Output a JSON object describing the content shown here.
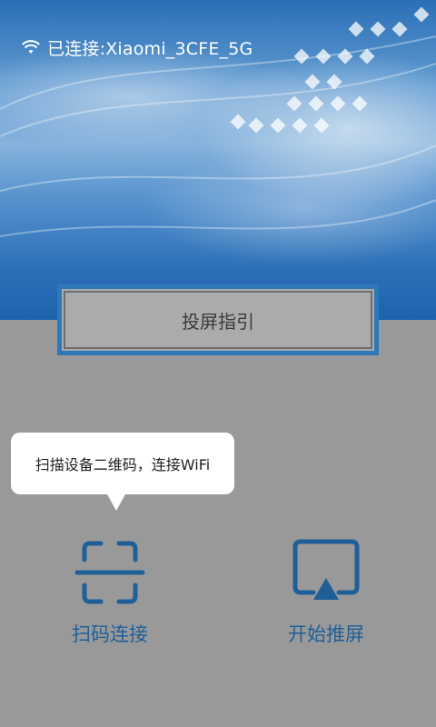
{
  "status_bar": {
    "wifi_icon": "wifi-icon",
    "connection_text": "已连接:Xiaomi_3CFE_5G"
  },
  "guide": {
    "label": "投屏指引"
  },
  "tooltip": {
    "text": "扫描设备二维码，连接WiFi"
  },
  "actions": [
    {
      "label": "扫码连接",
      "icon": "scan-qr-icon"
    },
    {
      "label": "开始推屏",
      "icon": "screen-cast-icon"
    }
  ],
  "colors": {
    "accent": "#1f5f98",
    "guide_border": "#2d79b8",
    "overlay": "#999999"
  }
}
